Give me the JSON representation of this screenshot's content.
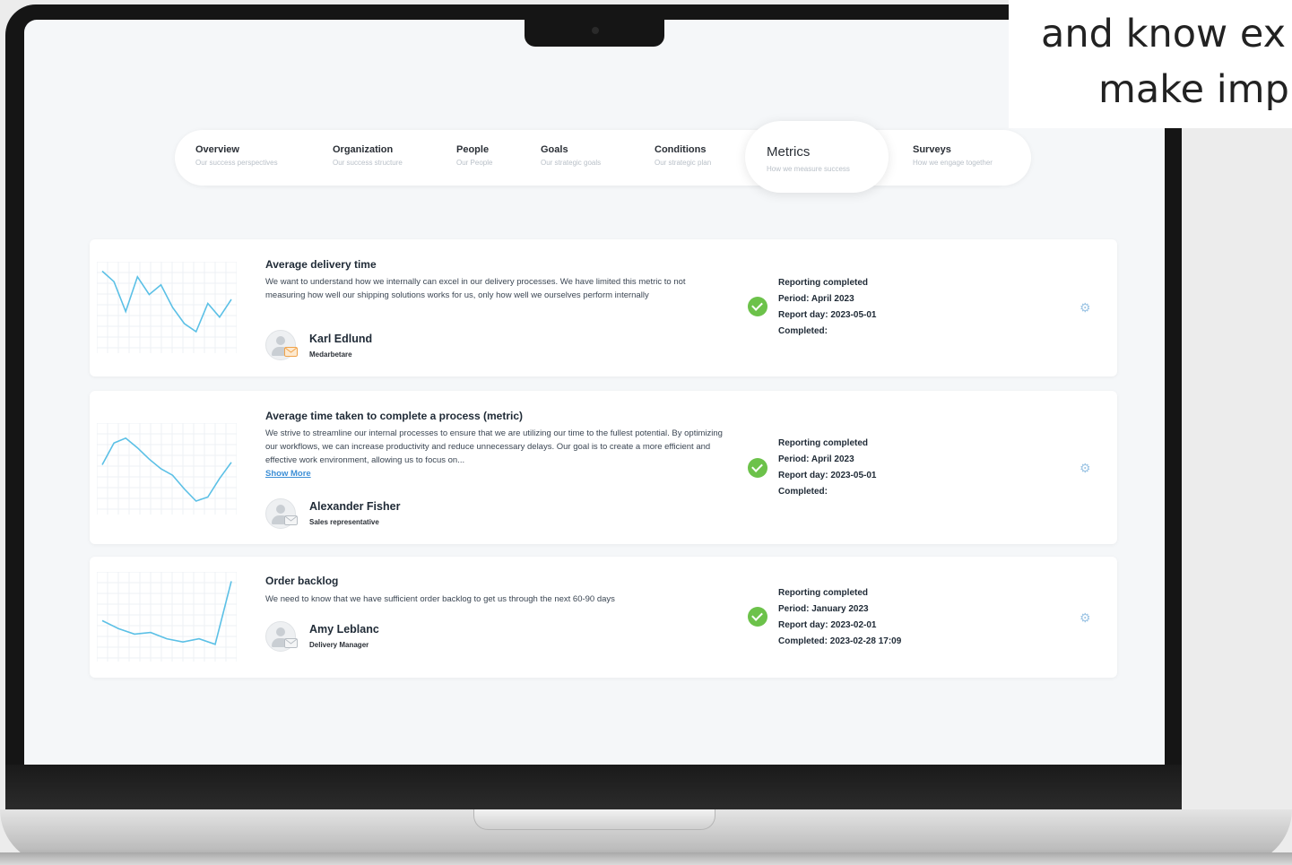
{
  "overlay": {
    "line1": "and know ex",
    "line2": "make imp"
  },
  "nav": {
    "tabs": [
      {
        "label": "Overview",
        "sub": "Our success perspectives"
      },
      {
        "label": "Organization",
        "sub": "Our success structure"
      },
      {
        "label": "People",
        "sub": "Our People"
      },
      {
        "label": "Goals",
        "sub": "Our strategic goals"
      },
      {
        "label": "Conditions",
        "sub": "Our strategic plan"
      },
      {
        "label": "Metrics",
        "sub": "How we measure success",
        "active": true
      },
      {
        "label": "Surveys",
        "sub": "How we engage together"
      }
    ]
  },
  "metrics": [
    {
      "title": "Average delivery time",
      "description": "We want to understand how we internally can excel in our delivery processes. We have limited this metric to not measuring how well our shipping solutions works for us, only how well we ourselves perform internally",
      "show_more": "",
      "person": "Karl Edlund",
      "role": "Medarbetare",
      "status": "Reporting completed",
      "period": "Period: April 2023",
      "report_day": "Report day: 2023-05-01",
      "completed": "Completed:",
      "trend": [
        95,
        82,
        45,
        88,
        66,
        78,
        50,
        30,
        20,
        55,
        38,
        60
      ]
    },
    {
      "title": "Average time taken to complete a process (metric)",
      "description": "We strive to streamline our internal processes to ensure that we are utilizing our time to the fullest potential. By optimizing our workflows, we can increase productivity and reduce unnecessary delays. Our goal is to create a more efficient and effective work environment, allowing us to focus on...",
      "show_more": "Show More",
      "person": "Alexander Fisher",
      "role": "Sales representative",
      "status": "Reporting completed",
      "period": "Period: April 2023",
      "report_day": "Report day: 2023-05-01",
      "completed": "Completed:",
      "trend": [
        55,
        82,
        88,
        76,
        62,
        50,
        42,
        25,
        10,
        15,
        38,
        58
      ]
    },
    {
      "title": "Order backlog",
      "description": "We need to know that we have sufficient order backlog to get us through the next 60-90 days",
      "show_more": "",
      "person": "Amy Leblanc",
      "role": "Delivery Manager",
      "status": "Reporting completed",
      "period": "Period: January 2023",
      "report_day": "Report day: 2023-02-01",
      "completed": "Completed: 2023-02-28 17:09",
      "trend": [
        45,
        35,
        28,
        30,
        22,
        18,
        22,
        15,
        95
      ]
    }
  ],
  "colors": {
    "accent": "#5bc0e6",
    "check": "#6cc24a",
    "link": "#3d8fd6"
  }
}
